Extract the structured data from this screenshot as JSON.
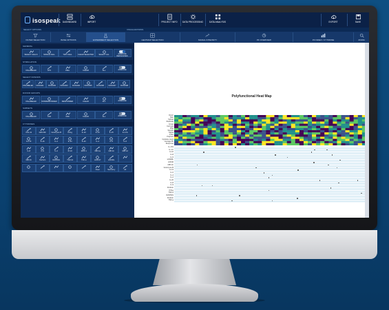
{
  "app": {
    "brand": "isospeak"
  },
  "topbar": {
    "items": [
      {
        "name": "dashboard",
        "label": "DASHBOARD"
      },
      {
        "name": "import",
        "label": "IMPORT"
      },
      {
        "name": "project-info",
        "label": "PROJECT INFO"
      },
      {
        "name": "data-processing",
        "label": "DATA PROCESSING"
      },
      {
        "name": "data-analysis",
        "label": "DATA ANALYSIS"
      },
      {
        "name": "export",
        "label": "EXPORT"
      },
      {
        "name": "save",
        "label": "SAVE"
      }
    ]
  },
  "section_strip": {
    "left": "SELECT OPTIONS",
    "right": "VISUALIZATIONS"
  },
  "tabs": [
    {
      "label": "FILTER SELECTION",
      "active": false
    },
    {
      "label": "BASE OPTIONS",
      "active": false
    },
    {
      "label": "EXPERIMENT SELECTION",
      "active": true
    },
    {
      "label": "HEATMAP SELECTION",
      "active": false
    },
    {
      "label": "SIGNAL INTENSITY",
      "active": false
    },
    {
      "label": "PF OVERVIEW",
      "active": false
    },
    {
      "label": "PF INDEX / CYTOKINE",
      "active": false
    },
    {
      "label": "ZOOM",
      "active": false
    }
  ],
  "sidebar": {
    "sections": [
      {
        "title": "GENERAL",
        "buttons": [
          "SELECT CELLS",
          "SINGLE CELL",
          "TWO CELL",
          "CLEAR SELECTED",
          "SELECT ALL",
          "AVERAGE REPLICATES"
        ]
      },
      {
        "title": "STIMULATION",
        "buttons": [
          "UNLABELED",
          "LPS",
          "PMA",
          "CLEAR",
          "ALL",
          "AVERAGE"
        ]
      },
      {
        "title": "SELECT DONORS",
        "buttons": [
          "UNLABELED",
          "DONOR1",
          "DONOR2",
          "DONOR3",
          "DONOR4",
          "DONOR5",
          "DONOR6",
          "DONOR7",
          "DONOR8"
        ]
      },
      {
        "title": "DONOR GROUPS",
        "buttons": [
          "UNLABELED",
          "NONRESPONDER",
          "RESPONDER",
          "CLEAR",
          "ALL",
          "AVERAGE"
        ]
      },
      {
        "title": "SUBSETS",
        "buttons": [
          "UNLABELED",
          "CD4",
          "CD8",
          "CLEAR",
          "ALL",
          "AVERAGE"
        ]
      },
      {
        "title": "CYTOKINES",
        "buttons": [
          "CCL-11",
          "GM-CSF",
          "Granzyme B",
          "IFN-g",
          "IL-10",
          "IL-13",
          "IL-15",
          "IL-17A",
          "IL-17F",
          "IL-1b",
          "IL-2",
          "IL-21",
          "IL-22",
          "IL-4",
          "IL-5",
          "IL-6",
          "IL-8",
          "IL-9",
          "IL-2",
          "IP-10",
          "MCP-1",
          "MIP-1a",
          "MIP-1b",
          "MIP-1d",
          "MIP-1b",
          "Perforin",
          "RANTES",
          "TGF-b1",
          "TNF-a",
          "sCD137",
          "sCD40L",
          "",
          "",
          "",
          "",
          "",
          "",
          "Clear",
          "Secretory",
          "All"
        ]
      }
    ]
  },
  "main": {
    "chart_title": "Polyfunctional Heat Map"
  },
  "chart_data": {
    "type": "heatmap",
    "title": "Polyfunctional Heat Map",
    "heatmap_rows": [
      "Donor",
      "Stim",
      "Subset",
      "Replicate",
      "Group",
      "Cell type",
      "Chip",
      "Sample",
      "Signal",
      "Index",
      "Polyfunc",
      "Cytokine count",
      "Average PF",
      "Response"
    ],
    "dot_rows": [
      "IL-17A",
      "IL-1 b",
      "IL-10",
      "IL-8",
      "IL-5",
      "sCD40L",
      "sCD40",
      "MIP-1b",
      "Granzyme B",
      "IL-13",
      "IL-6",
      "IL-4",
      "IL-2",
      "IL-22",
      "IL-8",
      "IL-9",
      "Perforin",
      "IFN-g",
      "TNF-a",
      "RANTES",
      "Perforin",
      "TNF-a"
    ],
    "palette": [
      "#440154",
      "#3b528b",
      "#21908c",
      "#5dc863",
      "#fde725"
    ]
  }
}
